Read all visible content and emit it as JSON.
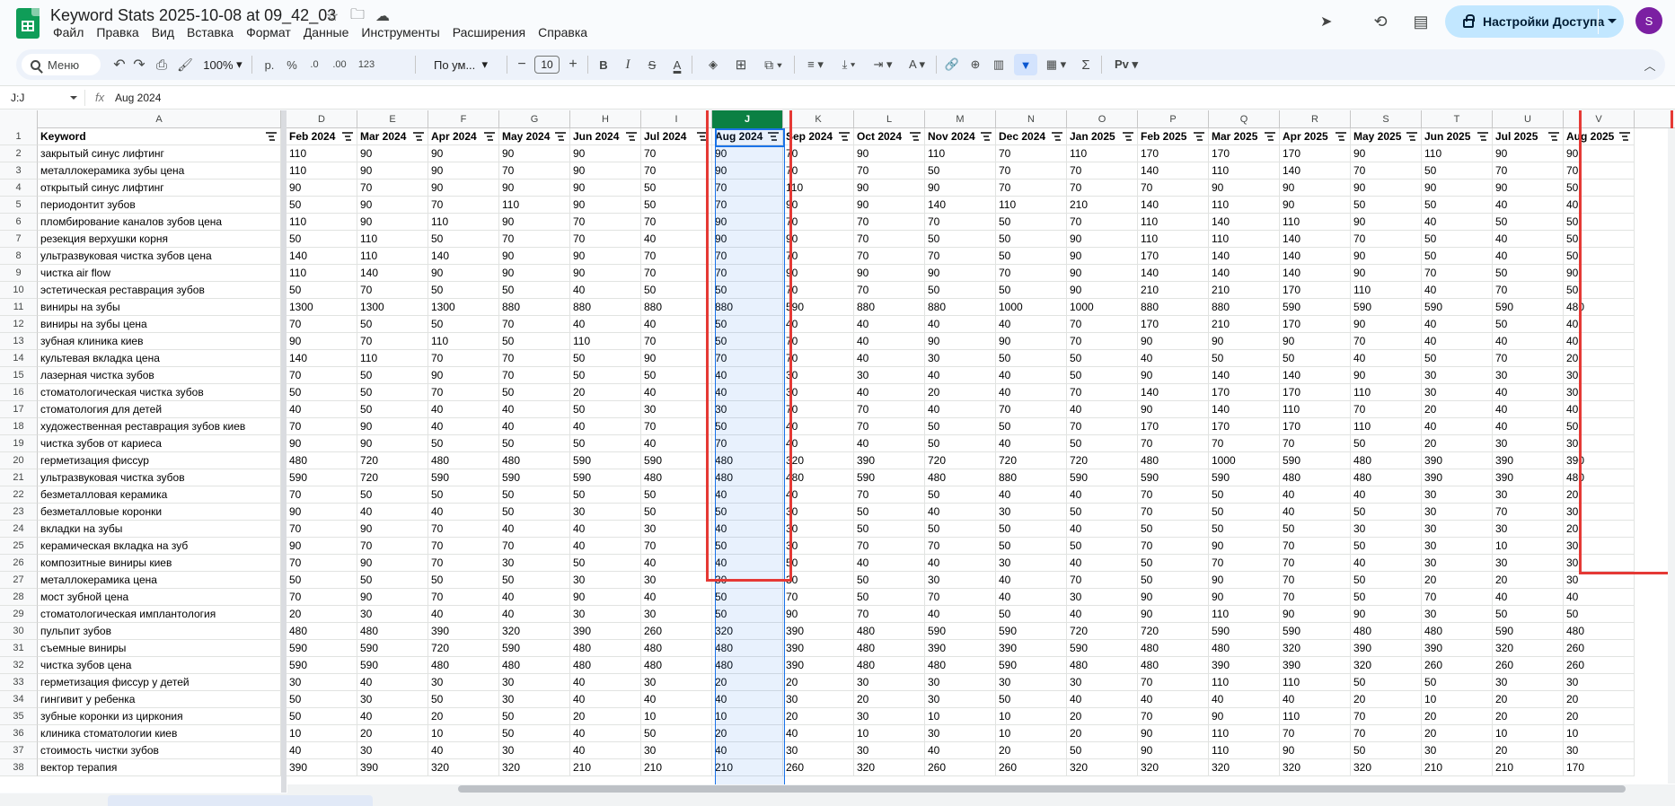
{
  "app": {
    "title": "Keyword Stats 2025-10-08 at 09_42_03",
    "menu": [
      "Файл",
      "Правка",
      "Вид",
      "Вставка",
      "Формат",
      "Данные",
      "Инструменты",
      "Расширения",
      "Справка"
    ],
    "share_label": "Настройки Доступа",
    "avatar_letter": "S"
  },
  "toolbar": {
    "search_label": "Меню",
    "zoom": "100%",
    "currency": "р.",
    "percent": "%",
    "dec_less": ".0",
    "dec_more": ".00",
    "number_format": "123",
    "font": "По ум...",
    "font_size": "10",
    "minus": "−",
    "plus": "+",
    "sigma": "Σ"
  },
  "formula_bar": {
    "name_box": "J:J",
    "fx": "fx",
    "value": "Aug 2024"
  },
  "sheet": {
    "columns": [
      "A",
      "D",
      "E",
      "F",
      "G",
      "H",
      "I",
      "J",
      "K",
      "L",
      "M",
      "N",
      "O",
      "P",
      "Q",
      "R",
      "S",
      "T",
      "U",
      "V"
    ],
    "header": [
      "Keyword",
      "Feb 2024",
      "Mar 2024",
      "Apr 2024",
      "May 2024",
      "Jun 2024",
      "Jul 2024",
      "Aug 2024",
      "Sep 2024",
      "Oct 2024",
      "Nov 2024",
      "Dec 2024",
      "Jan 2025",
      "Feb 2025",
      "Mar 2025",
      "Apr 2025",
      "May 2025",
      "Jun 2025",
      "Jul 2025",
      "Aug 2025"
    ],
    "row_numbers": [
      "1",
      "2",
      "3",
      "4",
      "5",
      "6",
      "7",
      "8",
      "9",
      "10",
      "11",
      "12",
      "13",
      "14",
      "15",
      "16",
      "17",
      "18",
      "19",
      "20",
      "21",
      "22",
      "23",
      "24",
      "25",
      "26",
      "27",
      "28",
      "29",
      "30",
      "31",
      "32",
      "33",
      "34",
      "35",
      "36",
      "37",
      "38"
    ],
    "rows": [
      [
        "закрытый синус лифтинг",
        "110",
        "90",
        "90",
        "90",
        "90",
        "70",
        "90",
        "70",
        "90",
        "110",
        "70",
        "110",
        "170",
        "170",
        "170",
        "90",
        "110",
        "90",
        "90"
      ],
      [
        "металлокерамика зубы цена",
        "110",
        "90",
        "90",
        "70",
        "90",
        "70",
        "90",
        "70",
        "70",
        "50",
        "70",
        "70",
        "140",
        "110",
        "140",
        "70",
        "50",
        "70",
        "70"
      ],
      [
        "открытый синус лифтинг",
        "90",
        "70",
        "90",
        "90",
        "90",
        "50",
        "70",
        "110",
        "90",
        "90",
        "70",
        "70",
        "70",
        "90",
        "90",
        "90",
        "90",
        "90",
        "50"
      ],
      [
        "периодонтит зубов",
        "50",
        "90",
        "70",
        "110",
        "90",
        "50",
        "70",
        "90",
        "90",
        "140",
        "110",
        "210",
        "140",
        "110",
        "90",
        "50",
        "50",
        "40",
        "40"
      ],
      [
        "пломбирование каналов зубов цена",
        "110",
        "90",
        "110",
        "90",
        "70",
        "70",
        "90",
        "70",
        "70",
        "70",
        "50",
        "70",
        "110",
        "140",
        "110",
        "90",
        "40",
        "50",
        "50"
      ],
      [
        "резекция верхушки корня",
        "50",
        "110",
        "50",
        "70",
        "70",
        "40",
        "90",
        "90",
        "70",
        "50",
        "50",
        "90",
        "110",
        "110",
        "140",
        "70",
        "50",
        "40",
        "50"
      ],
      [
        "ультразвуковая чистка зубов цена",
        "140",
        "110",
        "140",
        "90",
        "90",
        "70",
        "70",
        "70",
        "70",
        "70",
        "50",
        "90",
        "170",
        "140",
        "140",
        "90",
        "50",
        "40",
        "50"
      ],
      [
        "чистка air flow",
        "110",
        "140",
        "90",
        "90",
        "90",
        "70",
        "70",
        "90",
        "90",
        "90",
        "70",
        "90",
        "140",
        "140",
        "140",
        "90",
        "70",
        "50",
        "90"
      ],
      [
        "эстетическая реставрация зубов",
        "50",
        "70",
        "50",
        "50",
        "40",
        "50",
        "50",
        "70",
        "70",
        "50",
        "50",
        "90",
        "210",
        "210",
        "170",
        "110",
        "40",
        "70",
        "50"
      ],
      [
        "виниры на зубы",
        "1300",
        "1300",
        "1300",
        "880",
        "880",
        "880",
        "880",
        "590",
        "880",
        "880",
        "1000",
        "1000",
        "880",
        "880",
        "590",
        "590",
        "590",
        "590",
        "480"
      ],
      [
        "виниры на зубы цена",
        "70",
        "50",
        "50",
        "70",
        "40",
        "40",
        "50",
        "40",
        "40",
        "40",
        "40",
        "70",
        "170",
        "210",
        "170",
        "90",
        "40",
        "50",
        "40"
      ],
      [
        "зубная клиника киев",
        "90",
        "70",
        "110",
        "50",
        "110",
        "70",
        "50",
        "70",
        "40",
        "90",
        "90",
        "70",
        "90",
        "90",
        "90",
        "70",
        "40",
        "40",
        "40"
      ],
      [
        "культевая вкладка цена",
        "140",
        "110",
        "70",
        "70",
        "50",
        "90",
        "70",
        "70",
        "40",
        "30",
        "50",
        "50",
        "40",
        "50",
        "50",
        "40",
        "50",
        "70",
        "20"
      ],
      [
        "лазерная чистка зубов",
        "70",
        "50",
        "90",
        "70",
        "50",
        "50",
        "40",
        "30",
        "30",
        "40",
        "40",
        "50",
        "90",
        "140",
        "140",
        "90",
        "30",
        "30",
        "30"
      ],
      [
        "стоматологическая чистка зубов",
        "50",
        "50",
        "70",
        "50",
        "20",
        "40",
        "40",
        "30",
        "40",
        "20",
        "40",
        "70",
        "140",
        "170",
        "170",
        "110",
        "30",
        "40",
        "30"
      ],
      [
        "стоматология для детей",
        "40",
        "50",
        "40",
        "40",
        "50",
        "30",
        "30",
        "70",
        "70",
        "40",
        "70",
        "40",
        "90",
        "140",
        "110",
        "70",
        "20",
        "40",
        "40"
      ],
      [
        "художественная реставрация зубов киев",
        "70",
        "90",
        "40",
        "40",
        "40",
        "70",
        "50",
        "40",
        "70",
        "50",
        "50",
        "70",
        "170",
        "170",
        "170",
        "110",
        "40",
        "40",
        "50"
      ],
      [
        "чистка зубов от кариеса",
        "90",
        "90",
        "50",
        "50",
        "50",
        "40",
        "70",
        "40",
        "40",
        "50",
        "40",
        "50",
        "70",
        "70",
        "70",
        "50",
        "20",
        "30",
        "30"
      ],
      [
        "герметизация фиссур",
        "480",
        "720",
        "480",
        "480",
        "590",
        "590",
        "480",
        "320",
        "390",
        "720",
        "720",
        "720",
        "480",
        "1000",
        "590",
        "480",
        "390",
        "390",
        "390"
      ],
      [
        "ультразвуковая чистка зубов",
        "590",
        "720",
        "590",
        "590",
        "590",
        "480",
        "480",
        "480",
        "590",
        "480",
        "880",
        "590",
        "590",
        "590",
        "480",
        "480",
        "390",
        "390",
        "480"
      ],
      [
        "безметалловая керамика",
        "70",
        "50",
        "50",
        "50",
        "50",
        "50",
        "40",
        "40",
        "70",
        "50",
        "40",
        "40",
        "70",
        "50",
        "40",
        "40",
        "30",
        "30",
        "20"
      ],
      [
        "безметалловые коронки",
        "90",
        "40",
        "40",
        "50",
        "30",
        "50",
        "50",
        "30",
        "50",
        "40",
        "30",
        "50",
        "70",
        "50",
        "40",
        "50",
        "30",
        "70",
        "30"
      ],
      [
        "вкладки на зубы",
        "70",
        "90",
        "70",
        "40",
        "40",
        "30",
        "40",
        "30",
        "50",
        "50",
        "50",
        "40",
        "50",
        "50",
        "50",
        "30",
        "30",
        "30",
        "20"
      ],
      [
        "керамическая вкладка на зуб",
        "90",
        "70",
        "70",
        "70",
        "40",
        "70",
        "50",
        "30",
        "70",
        "70",
        "50",
        "50",
        "70",
        "90",
        "70",
        "50",
        "30",
        "10",
        "30"
      ],
      [
        "композитные виниры киев",
        "70",
        "90",
        "70",
        "30",
        "50",
        "40",
        "40",
        "50",
        "40",
        "40",
        "30",
        "40",
        "50",
        "70",
        "70",
        "40",
        "30",
        "30",
        "30"
      ],
      [
        "металлокерамика цена",
        "50",
        "50",
        "50",
        "50",
        "30",
        "30",
        "30",
        "30",
        "50",
        "30",
        "40",
        "70",
        "50",
        "90",
        "70",
        "50",
        "20",
        "20",
        "30"
      ],
      [
        "мост зубной цена",
        "70",
        "90",
        "70",
        "40",
        "90",
        "40",
        "50",
        "70",
        "50",
        "70",
        "40",
        "30",
        "90",
        "90",
        "70",
        "50",
        "70",
        "40",
        "40"
      ],
      [
        "стоматологическая имплантология",
        "20",
        "30",
        "40",
        "40",
        "30",
        "30",
        "50",
        "90",
        "70",
        "40",
        "50",
        "40",
        "90",
        "110",
        "90",
        "90",
        "30",
        "50",
        "50"
      ],
      [
        "пульпит зубов",
        "480",
        "480",
        "390",
        "320",
        "390",
        "260",
        "320",
        "390",
        "480",
        "590",
        "590",
        "720",
        "720",
        "590",
        "590",
        "480",
        "480",
        "590",
        "480"
      ],
      [
        "съемные виниры",
        "590",
        "590",
        "720",
        "590",
        "480",
        "480",
        "480",
        "390",
        "480",
        "390",
        "390",
        "590",
        "480",
        "480",
        "320",
        "390",
        "390",
        "320",
        "260"
      ],
      [
        "чистка зубов цена",
        "590",
        "590",
        "480",
        "480",
        "480",
        "480",
        "480",
        "390",
        "480",
        "480",
        "590",
        "480",
        "480",
        "390",
        "390",
        "320",
        "260",
        "260",
        "260"
      ],
      [
        "герметизация фиссур у детей",
        "30",
        "40",
        "30",
        "30",
        "40",
        "30",
        "20",
        "20",
        "30",
        "30",
        "30",
        "30",
        "70",
        "110",
        "110",
        "50",
        "50",
        "30",
        "30"
      ],
      [
        "гингивит у ребенка",
        "50",
        "30",
        "50",
        "30",
        "40",
        "40",
        "40",
        "30",
        "20",
        "30",
        "50",
        "40",
        "40",
        "40",
        "40",
        "20",
        "10",
        "20",
        "20"
      ],
      [
        "зубные коронки из циркония",
        "50",
        "40",
        "20",
        "50",
        "20",
        "10",
        "10",
        "20",
        "30",
        "10",
        "10",
        "20",
        "70",
        "90",
        "110",
        "70",
        "20",
        "20",
        "20"
      ],
      [
        "клиника стоматологии киев",
        "10",
        "20",
        "10",
        "50",
        "40",
        "50",
        "20",
        "40",
        "10",
        "30",
        "10",
        "20",
        "90",
        "110",
        "70",
        "70",
        "20",
        "10",
        "10"
      ],
      [
        "стоимость чистки зубов",
        "40",
        "30",
        "40",
        "30",
        "40",
        "30",
        "40",
        "30",
        "30",
        "40",
        "20",
        "50",
        "90",
        "110",
        "90",
        "50",
        "30",
        "20",
        "30"
      ],
      [
        "вектор терапия",
        "390",
        "390",
        "320",
        "320",
        "210",
        "210",
        "210",
        "260",
        "320",
        "260",
        "260",
        "320",
        "320",
        "320",
        "320",
        "320",
        "210",
        "210",
        "170"
      ]
    ]
  }
}
